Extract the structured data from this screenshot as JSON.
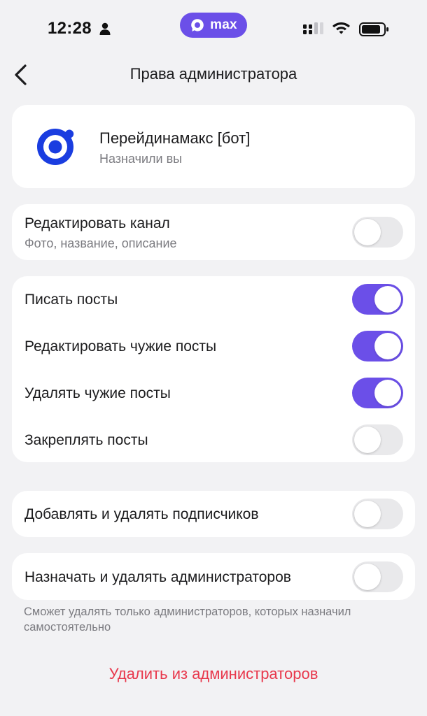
{
  "status_bar": {
    "time": "12:28",
    "app_pill_label": "max",
    "icons": [
      "person-icon",
      "max-logo-icon",
      "cellular-signal-icon",
      "wifi-icon",
      "battery-icon"
    ],
    "accent_color": "#6b4fe8"
  },
  "nav": {
    "title": "Права администратора",
    "back_icon": "chevron-left-icon"
  },
  "profile": {
    "name": "Перейдинамакс [бот]",
    "subtitle": "Назначили вы",
    "avatar_icon": "bot-logo-icon",
    "avatar_color": "#1a3de0"
  },
  "permissions": {
    "edit_channel": {
      "label": "Редактировать канал",
      "sub": "Фото, название, описание",
      "enabled": false
    },
    "write_posts": {
      "label": "Писать посты",
      "enabled": true
    },
    "edit_others_posts": {
      "label": "Редактировать чужие посты",
      "enabled": true
    },
    "delete_others_posts": {
      "label": "Удалять чужие посты",
      "enabled": true
    },
    "pin_posts": {
      "label": "Закреплять посты",
      "enabled": false
    },
    "manage_subscribers": {
      "label": "Добавлять и удалять подписчиков",
      "enabled": false
    },
    "manage_admins": {
      "label": "Назначать и удалять администраторов",
      "enabled": false
    }
  },
  "footnote": "Сможет удалять только администраторов, которых назначил самостоятельно",
  "remove_admin_label": "Удалить из администраторов",
  "colors": {
    "toggle_on": "#6b4fe8",
    "toggle_off": "#e9e9eb",
    "destructive": "#e8384c",
    "background": "#f2f2f4"
  }
}
